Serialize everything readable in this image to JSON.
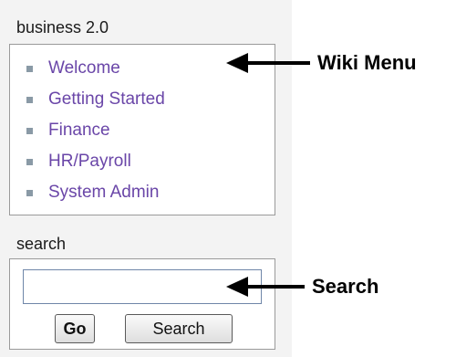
{
  "wiki_panel": {
    "title": "business 2.0",
    "items": [
      {
        "label": "Welcome"
      },
      {
        "label": "Getting Started"
      },
      {
        "label": "Finance"
      },
      {
        "label": "HR/Payroll"
      },
      {
        "label": "System Admin"
      }
    ]
  },
  "search_panel": {
    "title": "search",
    "input_value": "",
    "go_label": "Go",
    "search_label": "Search"
  },
  "annotations": {
    "wiki_menu": "Wiki Menu",
    "search": "Search"
  },
  "colors": {
    "link": "#6a46a8",
    "bullet": "#8a9aa6",
    "sidebar_bg": "#f3f3f3"
  }
}
